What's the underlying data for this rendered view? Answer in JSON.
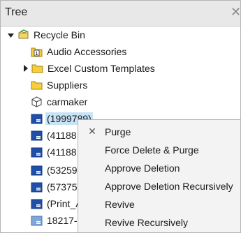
{
  "panel": {
    "title": "Tree",
    "close_icon": "close-icon"
  },
  "tree": {
    "root": {
      "label": "Recycle Bin",
      "icon": "recycle-bin-icon",
      "expanded": true
    },
    "items": [
      {
        "label": "Audio Accessories",
        "icon": "numbered-folder-icon"
      },
      {
        "label": "Excel Custom Templates",
        "icon": "folder-icon",
        "collapsed": true
      },
      {
        "label": "Suppliers",
        "icon": "folder-icon"
      },
      {
        "label": "carmaker",
        "icon": "cube-icon"
      },
      {
        "label": "(1999789)",
        "icon": "database-icon",
        "selected": true
      },
      {
        "label": "(41188",
        "icon": "database-icon"
      },
      {
        "label": "(41188",
        "icon": "database-icon"
      },
      {
        "label": "(53259",
        "icon": "database-icon"
      },
      {
        "label": "(57375",
        "icon": "database-icon"
      },
      {
        "label": "(Print_A",
        "icon": "database-icon"
      },
      {
        "label": "18217-",
        "icon": "database-light-icon"
      }
    ]
  },
  "context_menu": {
    "items": [
      {
        "label": "Purge",
        "icon": "close-x-icon"
      },
      {
        "label": "Force Delete & Purge"
      },
      {
        "label": "Approve Deletion"
      },
      {
        "label": "Approve Deletion Recursively"
      },
      {
        "label": "Revive"
      },
      {
        "label": "Revive Recursively"
      }
    ]
  },
  "colors": {
    "selection": "#c7e3f6",
    "folder": "#f5c518",
    "database": "#1f4fa8",
    "menu_bg": "#f3f3f3"
  }
}
